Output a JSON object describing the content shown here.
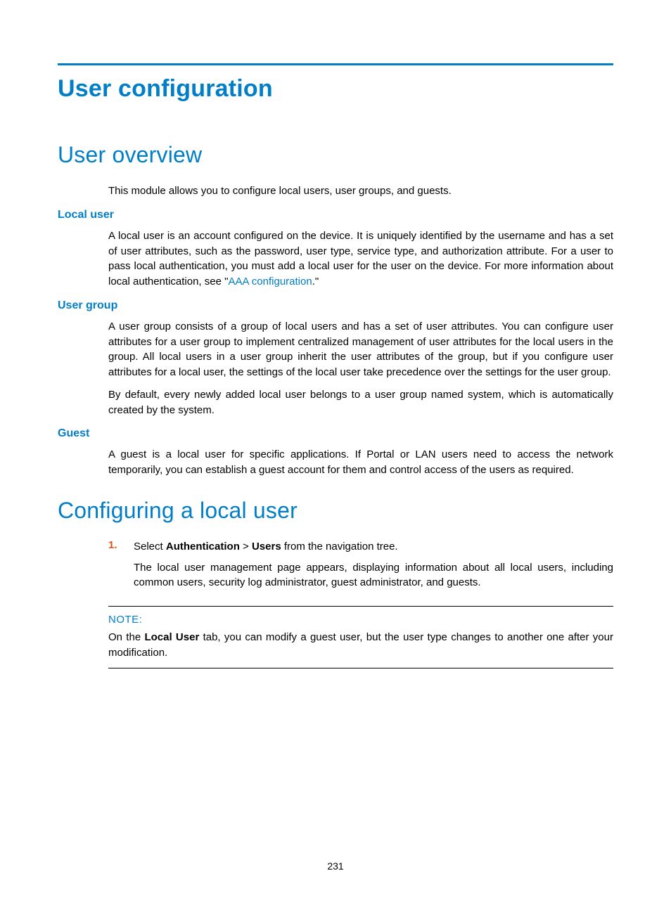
{
  "title": "User configuration",
  "sections": {
    "overview": {
      "heading": "User overview",
      "intro": "This module allows you to configure local users, user groups, and guests.",
      "local_user": {
        "heading": "Local user",
        "p1_a": "A local user is an account configured on the device. It is uniquely identified by the username and has a set of user attributes, such as the password, user type, service type, and authorization attribute. For a user to pass local authentication, you must add a local user for the user on the device. For more information about local authentication, see \"",
        "link": "AAA configuration",
        "p1_b": ".\""
      },
      "user_group": {
        "heading": "User group",
        "p1": "A user group consists of a group of local users and has a set of user attributes. You can configure user attributes for a user group to implement centralized management of user attributes for the local users in the group. All local users in a user group inherit the user attributes of the group, but if you configure user attributes for a local user, the settings of the local user take precedence over the settings for the user group.",
        "p2": "By default, every newly added local user belongs to a user group named system, which is automatically created by the system."
      },
      "guest": {
        "heading": "Guest",
        "p1": "A guest is a local user for specific applications. If Portal or LAN users need to access the network temporarily, you can establish a guest account for them and control access of the users as required."
      }
    },
    "configuring": {
      "heading": "Configuring a local user",
      "step1": {
        "num": "1.",
        "text_a": "Select ",
        "bold1": "Authentication",
        "text_b": " > ",
        "bold2": "Users",
        "text_c": " from the navigation tree.",
        "para": "The local user management page appears, displaying information about all local users, including common users, security log administrator, guest administrator, and guests."
      },
      "note": {
        "label": "NOTE:",
        "body_a": "On the ",
        "bold": "Local User",
        "body_b": " tab, you can modify a guest user, but the user type changes to another one after your modification."
      }
    }
  },
  "page_number": "231"
}
